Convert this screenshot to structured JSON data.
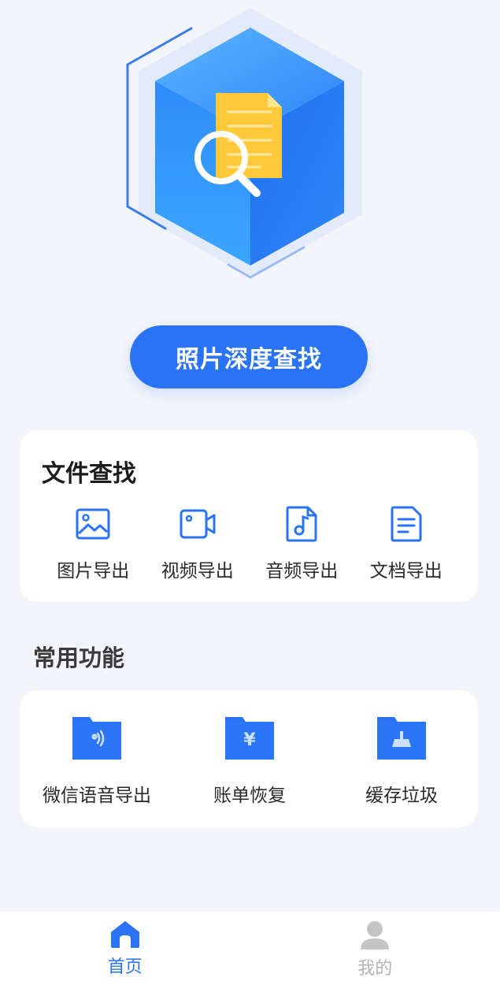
{
  "hero": {
    "illustration": "file-search-cube",
    "cta_label": "照片深度查找"
  },
  "file_search": {
    "title": "文件查找",
    "items": [
      {
        "label": "图片导出",
        "icon": "image-icon"
      },
      {
        "label": "视频导出",
        "icon": "video-icon"
      },
      {
        "label": "音频导出",
        "icon": "music-note-icon"
      },
      {
        "label": "文档导出",
        "icon": "document-icon"
      }
    ]
  },
  "common": {
    "title": "常用功能",
    "items": [
      {
        "label": "微信语音导出",
        "icon": "voice-folder-icon"
      },
      {
        "label": "账单恢复",
        "icon": "yuan-folder-icon"
      },
      {
        "label": "缓存垃圾",
        "icon": "broom-folder-icon"
      }
    ]
  },
  "tabbar": {
    "items": [
      {
        "label": "首页",
        "icon": "home-icon",
        "active": true
      },
      {
        "label": "我的",
        "icon": "user-icon",
        "active": false
      }
    ]
  },
  "colors": {
    "accent": "#2a73f4",
    "background": "#f3f5fa",
    "inactive": "#b3b3b3"
  }
}
